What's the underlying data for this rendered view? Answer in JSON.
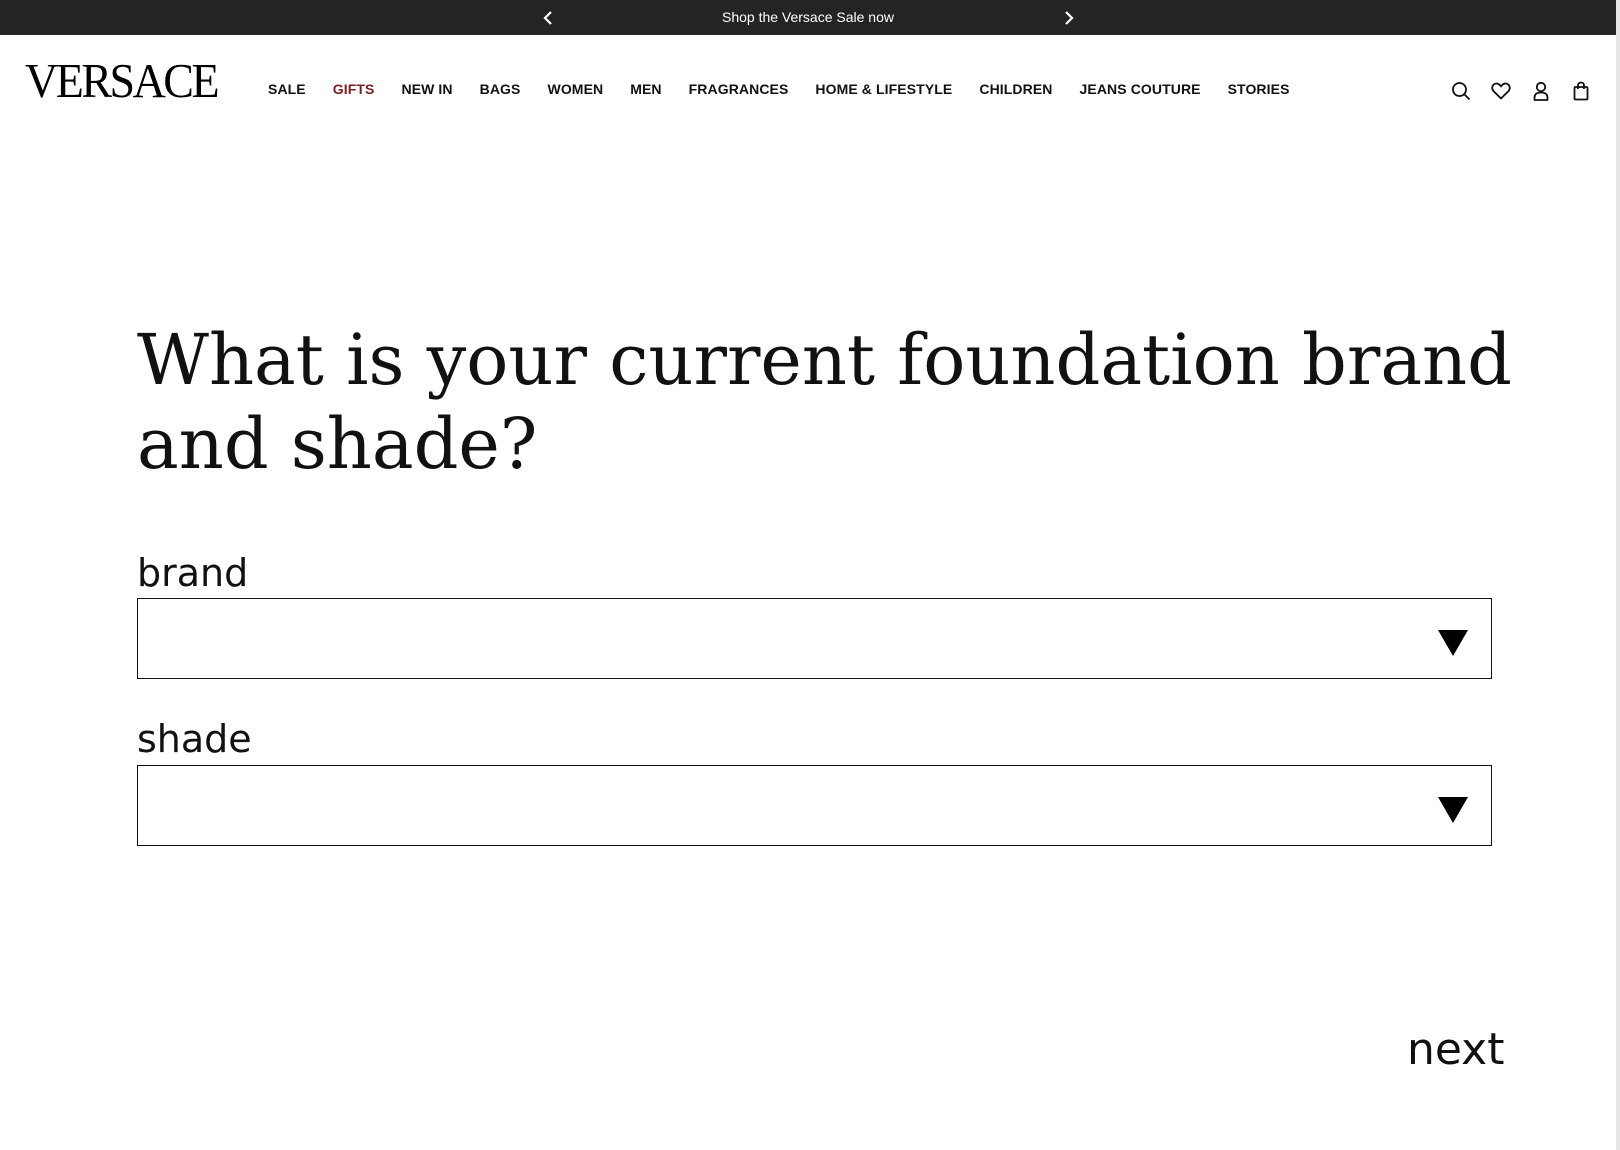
{
  "announcement": {
    "text": "Shop the Versace Sale now",
    "prev_icon": "chevron-left-icon",
    "next_icon": "chevron-right-icon"
  },
  "header": {
    "logo": "VERSACE",
    "nav": [
      {
        "label": "SALE"
      },
      {
        "label": "GIFTS",
        "color": "#7a2022"
      },
      {
        "label": "NEW IN"
      },
      {
        "label": "BAGS"
      },
      {
        "label": "WOMEN"
      },
      {
        "label": "MEN"
      },
      {
        "label": "FRAGRANCES"
      },
      {
        "label": "HOME & LIFESTYLE"
      },
      {
        "label": "CHILDREN"
      },
      {
        "label": "JEANS COUTURE"
      },
      {
        "label": "STORIES"
      }
    ],
    "icons": [
      "search-icon",
      "heart-icon",
      "user-icon",
      "shopping-bag-icon"
    ]
  },
  "form": {
    "question": "What is your current foundation brand and shade?",
    "brand_label": "brand",
    "brand_value": "",
    "shade_label": "shade",
    "shade_value": "",
    "next_label": "next"
  },
  "colors": {
    "announcement_bg": "#242424",
    "accent": "#7a2022",
    "text": "#111111"
  }
}
